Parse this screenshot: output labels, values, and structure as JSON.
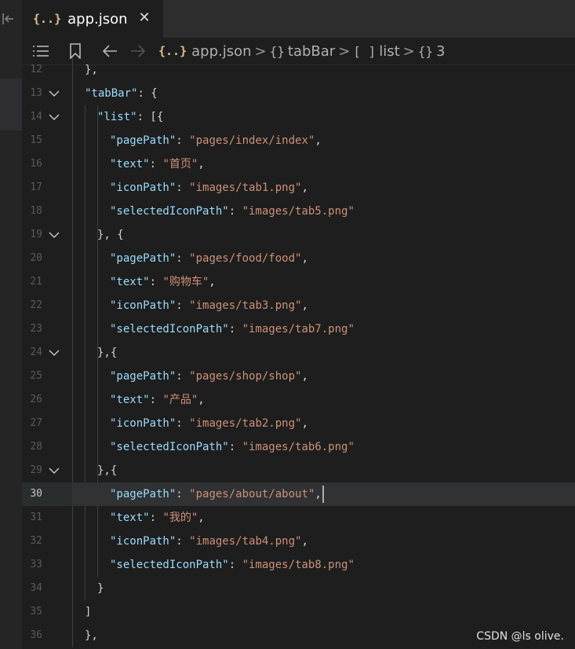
{
  "tab": {
    "icon": "{..}",
    "icon_name": "json-file-icon",
    "label": "app.json",
    "close": "✕"
  },
  "breadcrumb": {
    "file_icon": "{..}",
    "file": "app.json",
    "items": [
      {
        "icon": "{}",
        "label": "tabBar"
      },
      {
        "icon": "[ ]",
        "label": "list"
      },
      {
        "icon": "{}",
        "label": "3"
      }
    ],
    "separator": ">"
  },
  "toolbar": {
    "icons": [
      "list-icon",
      "bookmark-icon",
      "back-arrow-icon",
      "forward-arrow-icon"
    ]
  },
  "editor": {
    "current_line": 30,
    "lines": [
      {
        "n": "12",
        "text": "},"
      },
      {
        "n": "13",
        "text": "\"tabBar\": {"
      },
      {
        "n": "14",
        "text": "\"list\": [{"
      },
      {
        "n": "15",
        "text": "\"pagePath\": \"pages/index/index\","
      },
      {
        "n": "16",
        "text": "\"text\": \"首页\","
      },
      {
        "n": "17",
        "text": "\"iconPath\": \"images/tab1.png\","
      },
      {
        "n": "18",
        "text": "\"selectedIconPath\": \"images/tab5.png\""
      },
      {
        "n": "19",
        "text": "}, {"
      },
      {
        "n": "20",
        "text": "\"pagePath\": \"pages/food/food\","
      },
      {
        "n": "21",
        "text": "\"text\": \"购物车\","
      },
      {
        "n": "22",
        "text": "\"iconPath\": \"images/tab3.png\","
      },
      {
        "n": "23",
        "text": "\"selectedIconPath\": \"images/tab7.png\""
      },
      {
        "n": "24",
        "text": "},{"
      },
      {
        "n": "25",
        "text": "\"pagePath\": \"pages/shop/shop\","
      },
      {
        "n": "26",
        "text": "\"text\": \"产品\","
      },
      {
        "n": "27",
        "text": "\"iconPath\": \"images/tab2.png\","
      },
      {
        "n": "28",
        "text": "\"selectedIconPath\": \"images/tab6.png\""
      },
      {
        "n": "29",
        "text": "},{"
      },
      {
        "n": "30",
        "text": "\"pagePath\": \"pages/about/about\","
      },
      {
        "n": "31",
        "text": "\"text\": \"我的\","
      },
      {
        "n": "32",
        "text": "\"iconPath\": \"images/tab4.png\","
      },
      {
        "n": "33",
        "text": "\"selectedIconPath\": \"images/tab8.png\""
      },
      {
        "n": "34",
        "text": "}"
      },
      {
        "n": "35",
        "text": "]"
      },
      {
        "n": "36",
        "text": "},"
      }
    ]
  },
  "watermark": "CSDN @ls olive.",
  "colors": {
    "key": "#9cdcfe",
    "string": "#ce9178",
    "punct": "#d4d4d4",
    "json_icon": "#e2c08d"
  }
}
